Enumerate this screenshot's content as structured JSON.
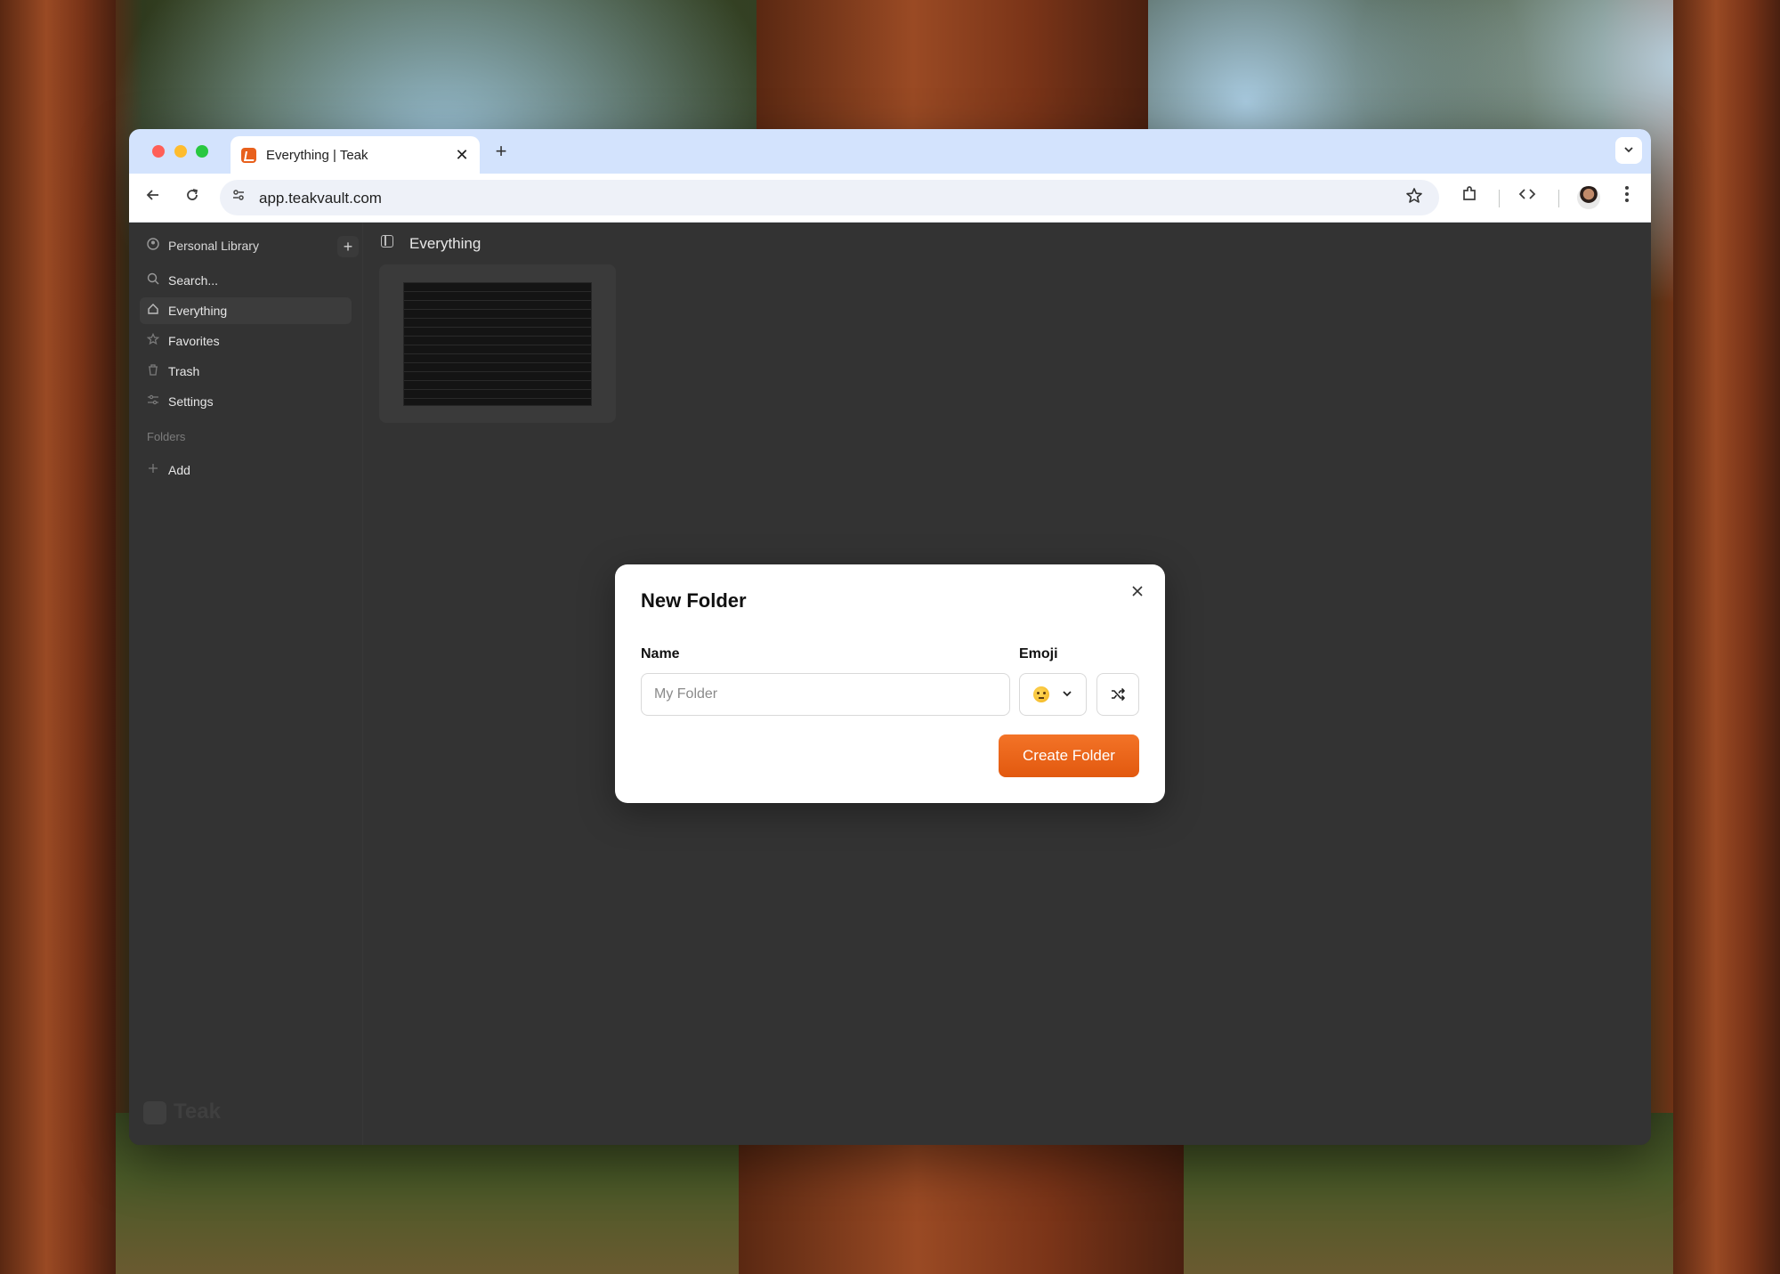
{
  "browser": {
    "tab_title": "Everything | Teak",
    "tab_close": "✕",
    "new_tab": "+",
    "tab_menu": "⌄",
    "url": "app.teakvault.com"
  },
  "sidebar": {
    "library_label": "Personal Library",
    "library_add": "+",
    "items": [
      {
        "label": "Search...",
        "icon": "search-icon"
      },
      {
        "label": "Everything",
        "icon": "home-icon",
        "active": true
      },
      {
        "label": "Favorites",
        "icon": "star-icon"
      },
      {
        "label": "Trash",
        "icon": "trash-icon"
      },
      {
        "label": "Settings",
        "icon": "sliders-icon"
      }
    ],
    "folders_heading": "Folders",
    "add_folder": "Add",
    "logo_text": "Teak"
  },
  "main": {
    "title": "Everything"
  },
  "modal": {
    "title": "New Folder",
    "name_label": "Name",
    "name_placeholder": "My Folder",
    "name_value": "",
    "emoji_label": "Emoji",
    "emoji_icon": "thinking-face-emoji",
    "create_label": "Create Folder"
  },
  "colors": {
    "accent": "#ea6419",
    "tabstrip": "#d3e3fd",
    "app_bg": "#333333"
  }
}
